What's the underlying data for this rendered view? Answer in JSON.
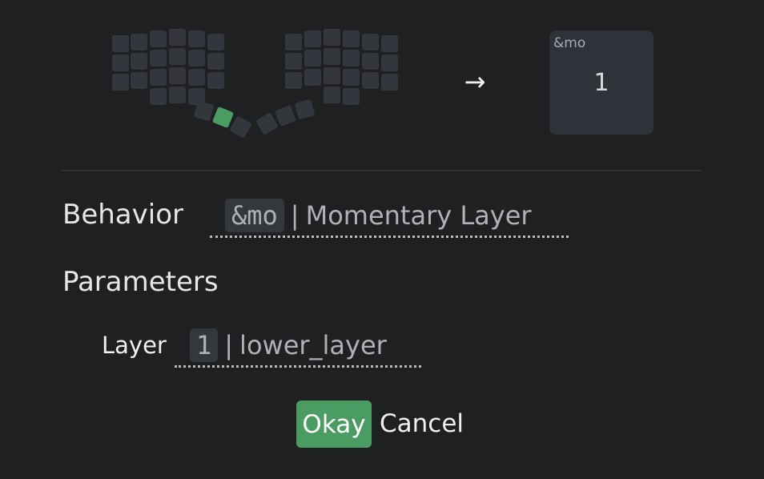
{
  "preview": {
    "binding": "&mo",
    "param": "1"
  },
  "arrow_icon": "arrow-right-icon",
  "behavior": {
    "label": "Behavior",
    "code": "&mo",
    "separator": "|",
    "name": "Momentary Layer"
  },
  "parameters": {
    "heading": "Parameters",
    "layer": {
      "label": "Layer",
      "code": "1",
      "separator": "|",
      "name": "lower_layer"
    }
  },
  "buttons": {
    "okay": "Okay",
    "cancel": "Cancel"
  },
  "colors": {
    "accent": "#4a9c62",
    "background": "#1f2022",
    "key": "#33373d"
  }
}
